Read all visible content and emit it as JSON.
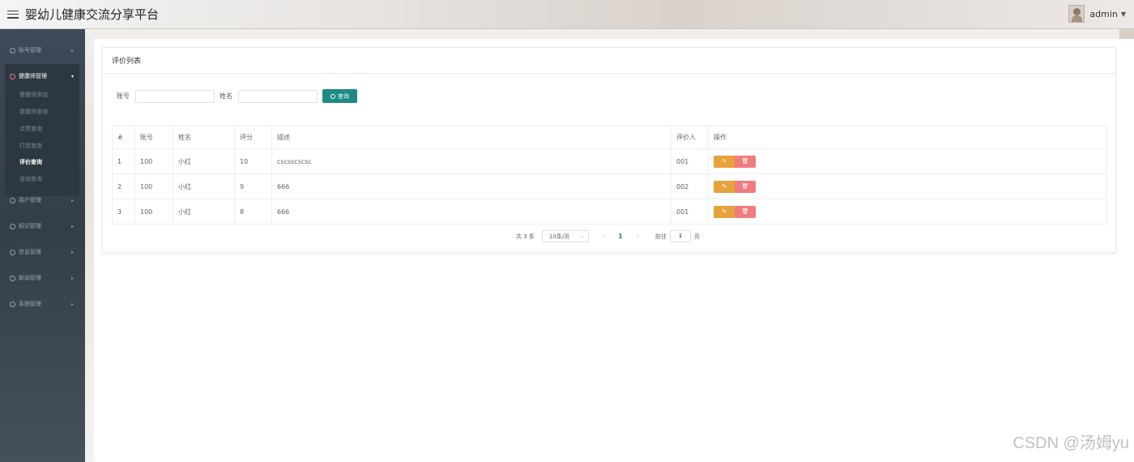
{
  "app": {
    "title": "婴幼儿健康交流分享平台"
  },
  "user": {
    "name": "admin"
  },
  "sidebar": {
    "items": [
      {
        "label": "账号管理"
      },
      {
        "label": "健康师管理"
      },
      {
        "label": "用户管理"
      },
      {
        "label": "知识管理"
      },
      {
        "label": "信息管理"
      },
      {
        "label": "新闻管理"
      },
      {
        "label": "系统管理"
      }
    ],
    "subitems": [
      {
        "label": "健康师添加"
      },
      {
        "label": "健康师查询"
      },
      {
        "label": "点赞查询"
      },
      {
        "label": "打赏查询"
      },
      {
        "label": "评价查询"
      },
      {
        "label": "咨询查询"
      }
    ]
  },
  "card": {
    "title": "评价列表"
  },
  "search": {
    "account_label": "账号",
    "name_label": "姓名",
    "button_label": "查询",
    "account_value": "",
    "name_value": ""
  },
  "table": {
    "headers": [
      "#",
      "账号",
      "姓名",
      "评分",
      "描述",
      "评价人",
      "操作"
    ],
    "rows": [
      [
        "1",
        "100",
        "小红",
        "10",
        "cscsscscsc",
        "001"
      ],
      [
        "2",
        "100",
        "小红",
        "9",
        "666",
        "002"
      ],
      [
        "3",
        "100",
        "小红",
        "8",
        "666",
        "001"
      ]
    ]
  },
  "pagination": {
    "total_text": "共 3 条",
    "page_size": "10条/页",
    "current_page": "1",
    "goto_label": "前往",
    "goto_value": "1",
    "page_suffix": "页"
  },
  "watermark": "CSDN @汤姆yu",
  "colors": {
    "primary": "#1d8a83",
    "edit": "#e6a23c",
    "delete": "#f07c7f",
    "sidebar": "#3a4652"
  }
}
